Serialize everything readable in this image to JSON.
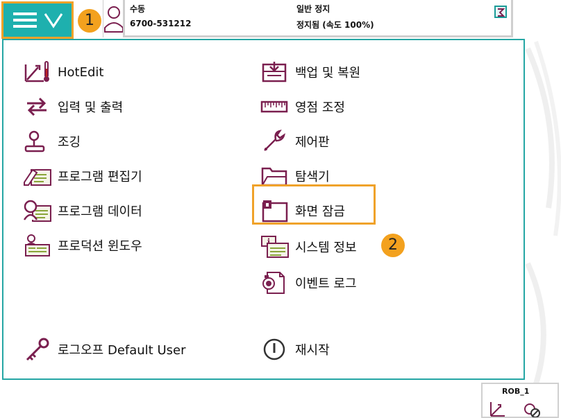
{
  "topbar": {
    "mode": "수동",
    "controller_id": "6700-531212",
    "state": "일반 정지",
    "speed_status": "정지됨 (속도 100%)"
  },
  "badges": {
    "first": "1",
    "second": "2"
  },
  "menu": {
    "left": [
      {
        "label": "HotEdit",
        "icon": "hotedit-icon"
      },
      {
        "label": "입력 및 출력",
        "icon": "io-arrows-icon"
      },
      {
        "label": "조깅",
        "icon": "joystick-icon"
      },
      {
        "label": "프로그램 편집기",
        "icon": "program-editor-icon"
      },
      {
        "label": "프로그램 데이터",
        "icon": "program-data-icon"
      },
      {
        "label": "프로덕션 윈도우",
        "icon": "production-window-icon"
      }
    ],
    "right": [
      {
        "label": "백업 및 복원",
        "icon": "backup-restore-icon"
      },
      {
        "label": "영점 조정",
        "icon": "calibration-ruler-icon"
      },
      {
        "label": "제어판",
        "icon": "wrench-icon"
      },
      {
        "label": "탐색기",
        "icon": "folder-icon"
      },
      {
        "label": "화면 잠금",
        "icon": "lock-screen-icon"
      },
      {
        "label": "시스템 정보",
        "icon": "system-info-icon"
      },
      {
        "label": "이벤트 로그",
        "icon": "event-log-icon"
      }
    ],
    "logout": "로그오프 Default User",
    "restart": "재시작"
  },
  "rob": {
    "label": "ROB_1"
  },
  "colors": {
    "accent_teal": "#1eb0ae",
    "highlight_orange": "#f0a22a",
    "icon_maroon": "#7a1f4f",
    "icon_green": "#8aa53a"
  }
}
